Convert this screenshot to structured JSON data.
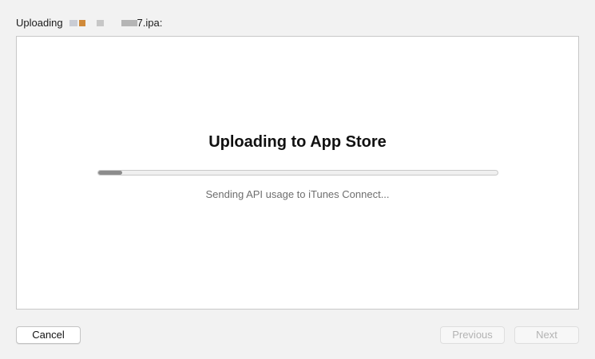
{
  "header": {
    "label": "Uploading",
    "filename_suffix": "7.ipa:"
  },
  "main": {
    "title": "Uploading to App Store",
    "progress": 0.06,
    "status": "Sending API usage to iTunes Connect..."
  },
  "buttons": {
    "cancel": "Cancel",
    "previous": "Previous",
    "next": "Next"
  },
  "colors": {
    "background": "#f2f2f2",
    "panel": "#ffffff",
    "progress_fill": "#8c8c8c",
    "disabled_text": "#b3b3b3"
  }
}
